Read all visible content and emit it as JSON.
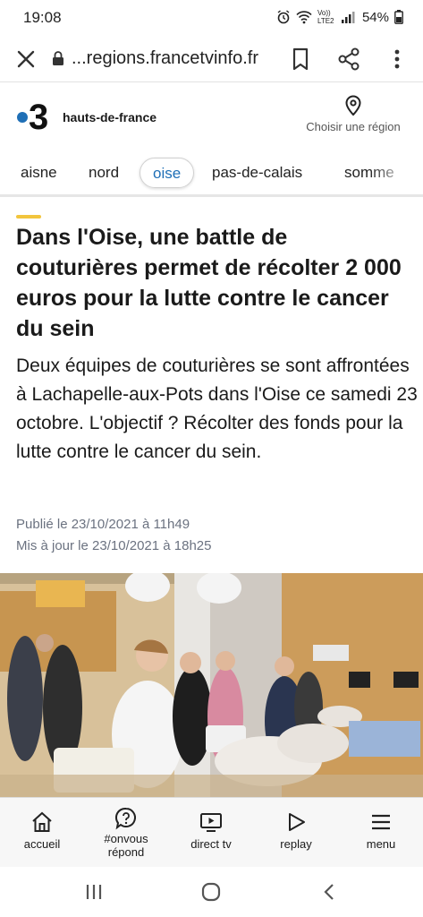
{
  "status_bar": {
    "time": "19:08",
    "network_label": "Vo)) LTE2",
    "battery": "54%"
  },
  "browser": {
    "url": "...regions.francetvinfo.fr",
    "icons": [
      "close-icon",
      "lock-icon",
      "bookmark-icon",
      "share-icon",
      "more-vert-icon"
    ]
  },
  "site": {
    "logo_text": "3",
    "name": "hauts-de-france",
    "region_button": "Choisir une région",
    "brand_blue": "#1f6fb6"
  },
  "tabs": [
    {
      "label": "aisne",
      "active": false
    },
    {
      "label": "nord",
      "active": false
    },
    {
      "label": "oise",
      "active": true
    },
    {
      "label": "pas-de-calais",
      "active": false
    },
    {
      "label": "somme",
      "active": false
    }
  ],
  "article": {
    "accent_color": "#f2c53d",
    "title": "Dans l'Oise, une battle de couturières permet de récolter 2 000 euros pour la lutte contre le cancer du sein",
    "lead": "Deux équipes de couturières se sont affrontées à Lachapelle-aux-Pots dans l'Oise ce samedi 23 octobre. L'objectif ? Récolter des fonds pour la lutte contre le cancer du sein.",
    "published": "Publié le 23/10/2021 à 11h49",
    "updated": "Mis à jour le 23/10/2021 à 18h25"
  },
  "bottom_nav": [
    {
      "label": "accueil",
      "icon": "home-icon"
    },
    {
      "label": "#onvous\nrépond",
      "icon": "chat-question-icon"
    },
    {
      "label": "direct tv",
      "icon": "tv-play-icon"
    },
    {
      "label": "replay",
      "icon": "play-icon"
    },
    {
      "label": "menu",
      "icon": "hamburger-icon"
    }
  ],
  "android_nav": [
    "recents-icon",
    "home-circle-icon",
    "back-chevron-icon"
  ]
}
